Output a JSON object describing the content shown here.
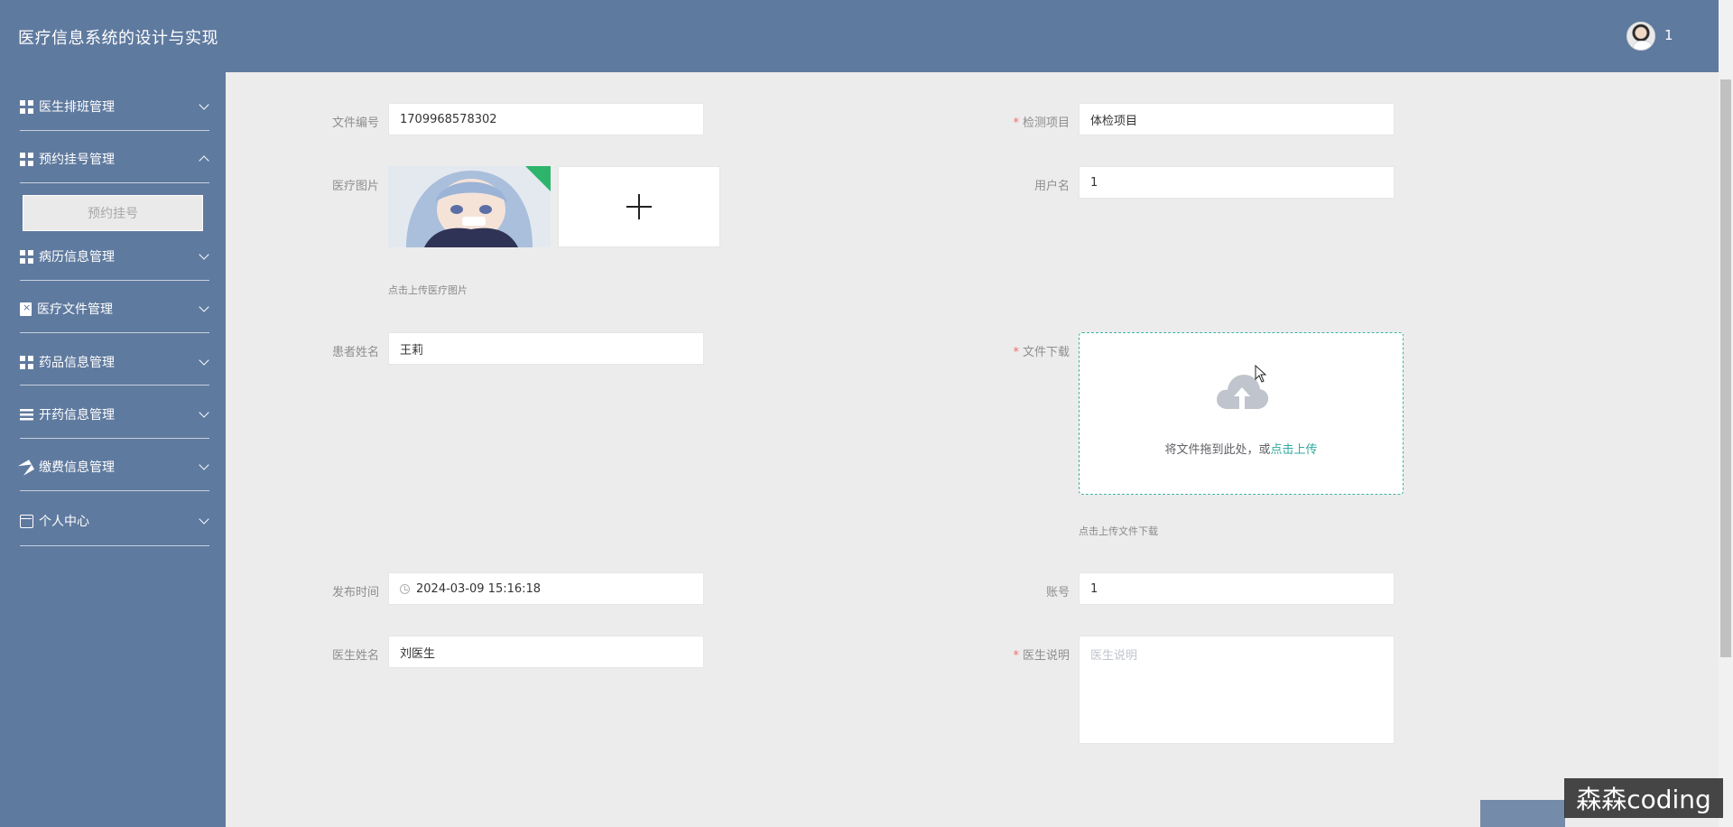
{
  "header": {
    "title": "医疗信息系统的设计与实现",
    "user_name": "1"
  },
  "sidebar": {
    "items": [
      {
        "label": "医生排班管理",
        "icon": "grid-icon"
      },
      {
        "label": "预约挂号管理",
        "icon": "grid-icon",
        "expanded": true
      },
      {
        "label": "病历信息管理",
        "icon": "grid-icon"
      },
      {
        "label": "医疗文件管理",
        "icon": "clipboard-icon"
      },
      {
        "label": "药品信息管理",
        "icon": "grid-icon"
      },
      {
        "label": "开药信息管理",
        "icon": "bars-icon"
      },
      {
        "label": "缴费信息管理",
        "icon": "paper-plane-icon"
      },
      {
        "label": "个人中心",
        "icon": "card-icon"
      }
    ],
    "sub_items": {
      "appointment": "预约挂号"
    }
  },
  "form": {
    "file_no": {
      "label": "文件编号",
      "value": "1709968578302"
    },
    "check_item": {
      "label": "检测项目",
      "value": "体检项目",
      "required": "*"
    },
    "medical_image": {
      "label": "医疗图片",
      "hint": "点击上传医疗图片"
    },
    "username": {
      "label": "用户名",
      "value": "1"
    },
    "patient_name": {
      "label": "患者姓名",
      "value": "王莉"
    },
    "file_download": {
      "label": "文件下载",
      "required": "*",
      "drop_text": "将文件拖到此处，或",
      "drop_link": "点击上传",
      "hint": "点击上传文件下载"
    },
    "publish_time": {
      "label": "发布时间",
      "value": "2024-03-09 15:16:18"
    },
    "account": {
      "label": "账号",
      "value": "1"
    },
    "doctor_name": {
      "label": "医生姓名",
      "value": "刘医生"
    },
    "doctor_note": {
      "label": "医生说明",
      "placeholder": "医生说明",
      "required": "*"
    }
  },
  "watermark": "森森coding",
  "colors": {
    "sidebar": "#5f7a9f",
    "background": "#ececec",
    "accent": "#2fa89d",
    "required": "#f56c6c"
  }
}
